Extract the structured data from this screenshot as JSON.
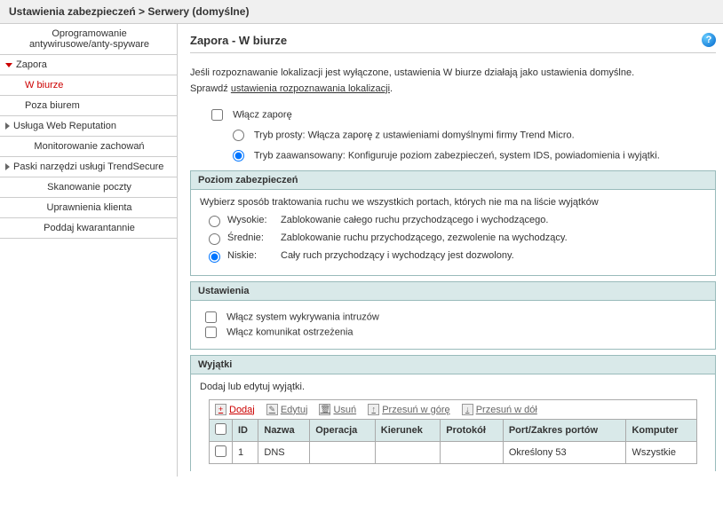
{
  "header": {
    "breadcrumb": "Ustawienia zabezpieczeń > Serwery (domyślne)"
  },
  "sidebar": {
    "items": [
      {
        "label": "Oprogramowanie antywirusowe/anty-spyware"
      },
      {
        "label": "Zapora",
        "expanded": true,
        "children": [
          {
            "label": "W biurze",
            "active": true
          },
          {
            "label": "Poza biurem"
          }
        ]
      },
      {
        "label": "Usługa Web Reputation",
        "collapsible": true
      },
      {
        "label": "Monitorowanie zachowań"
      },
      {
        "label": "Paski narzędzi usługi TrendSecure",
        "collapsible": true
      },
      {
        "label": "Skanowanie poczty"
      },
      {
        "label": "Uprawnienia klienta"
      },
      {
        "label": "Poddaj kwarantannie"
      }
    ]
  },
  "main": {
    "title": "Zapora - W biurze",
    "intro_line1": "Jeśli rozpoznawanie lokalizacji jest wyłączone, ustawienia W biurze działają jako ustawienia domyślne.",
    "intro_prefix": "Sprawdź ",
    "intro_link": "ustawienia rozpoznawania lokalizacji",
    "enable_label": "Włącz zaporę",
    "mode_simple": "Tryb prosty: Włącza zaporę z ustawieniami domyślnymi firmy Trend Micro.",
    "mode_advanced": "Tryb zaawansowany: Konfiguruje poziom zabezpieczeń, system IDS, powiadomienia i wyjątki.",
    "security": {
      "header": "Poziom zabezpieczeń",
      "desc": "Wybierz sposób traktowania ruchu we wszystkich portach, których nie ma na liście wyjątków",
      "high": {
        "label": "Wysokie:",
        "text": "Zablokowanie całego ruchu przychodzącego i wychodzącego."
      },
      "medium": {
        "label": "Średnie:",
        "text": "Zablokowanie ruchu przychodzącego, zezwolenie na wychodzący."
      },
      "low": {
        "label": "Niskie:",
        "text": "Cały ruch przychodzący i wychodzący jest dozwolony."
      }
    },
    "settings": {
      "header": "Ustawienia",
      "ids": "Włącz system wykrywania intruzów",
      "warn": "Włącz komunikat ostrzeżenia"
    },
    "exceptions": {
      "header": "Wyjątki",
      "desc": "Dodaj lub edytuj wyjątki.",
      "toolbar": {
        "add": "Dodaj",
        "edit": "Edytuj",
        "del": "Usuń",
        "up": "Przesuń w górę",
        "down": "Przesuń w dół"
      },
      "columns": {
        "id": "ID",
        "name": "Nazwa",
        "op": "Operacja",
        "dir": "Kierunek",
        "proto": "Protokół",
        "port": "Port/Zakres portów",
        "comp": "Komputer"
      },
      "rows": [
        {
          "id": "1",
          "name": "DNS",
          "op": "",
          "dir": "",
          "proto": "",
          "port": "Określony 53",
          "comp": "Wszystkie"
        }
      ]
    }
  }
}
